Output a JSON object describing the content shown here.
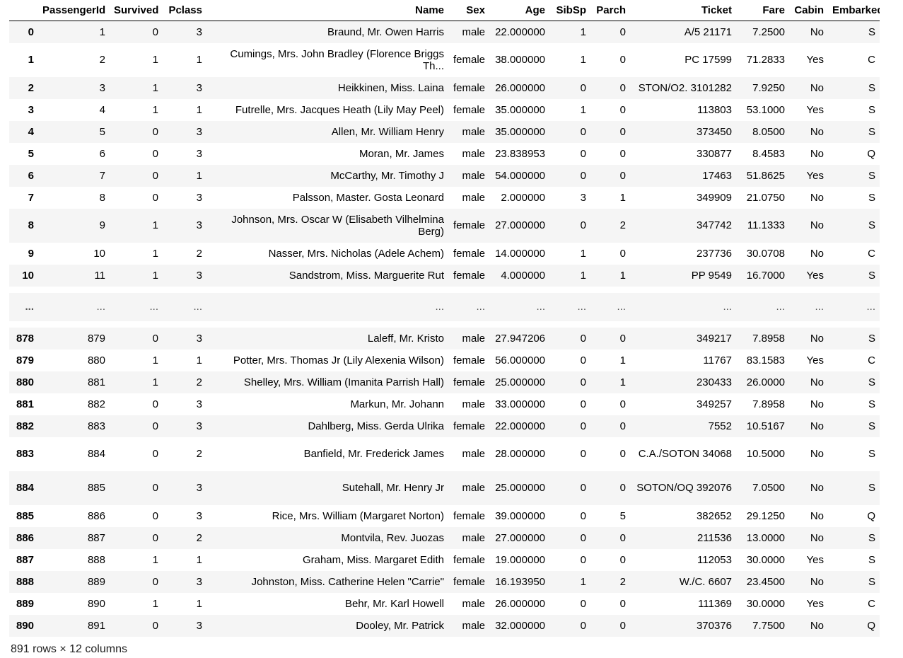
{
  "columns": [
    "",
    "PassengerId",
    "Survived",
    "Pclass",
    "Name",
    "Sex",
    "Age",
    "SibSp",
    "Parch",
    "Ticket",
    "Fare",
    "Cabin",
    "Embarked"
  ],
  "top_rows": [
    {
      "idx": "0",
      "cells": [
        "1",
        "0",
        "3",
        "Braund, Mr. Owen Harris",
        "male",
        "22.000000",
        "1",
        "0",
        "A/5 21171",
        "7.2500",
        "No",
        "S"
      ],
      "h": 31
    },
    {
      "idx": "1",
      "cells": [
        "2",
        "1",
        "1",
        "Cumings, Mrs. John Bradley (Florence Briggs Th...",
        "female",
        "38.000000",
        "1",
        "0",
        "PC 17599",
        "71.2833",
        "Yes",
        "C"
      ],
      "h": 48
    },
    {
      "idx": "2",
      "cells": [
        "3",
        "1",
        "3",
        "Heikkinen, Miss. Laina",
        "female",
        "26.000000",
        "0",
        "0",
        "STON/O2. 3101282",
        "7.9250",
        "No",
        "S"
      ],
      "h": 31
    },
    {
      "idx": "3",
      "cells": [
        "4",
        "1",
        "1",
        "Futrelle, Mrs. Jacques Heath (Lily May Peel)",
        "female",
        "35.000000",
        "1",
        "0",
        "113803",
        "53.1000",
        "Yes",
        "S"
      ],
      "h": 31
    },
    {
      "idx": "4",
      "cells": [
        "5",
        "0",
        "3",
        "Allen, Mr. William Henry",
        "male",
        "35.000000",
        "0",
        "0",
        "373450",
        "8.0500",
        "No",
        "S"
      ],
      "h": 31
    },
    {
      "idx": "5",
      "cells": [
        "6",
        "0",
        "3",
        "Moran, Mr. James",
        "male",
        "23.838953",
        "0",
        "0",
        "330877",
        "8.4583",
        "No",
        "Q"
      ],
      "h": 31
    },
    {
      "idx": "6",
      "cells": [
        "7",
        "0",
        "1",
        "McCarthy, Mr. Timothy J",
        "male",
        "54.000000",
        "0",
        "0",
        "17463",
        "51.8625",
        "Yes",
        "S"
      ],
      "h": 31
    },
    {
      "idx": "7",
      "cells": [
        "8",
        "0",
        "3",
        "Palsson, Master. Gosta Leonard",
        "male",
        "2.000000",
        "3",
        "1",
        "349909",
        "21.0750",
        "No",
        "S"
      ],
      "h": 31
    },
    {
      "idx": "8",
      "cells": [
        "9",
        "1",
        "3",
        "Johnson, Mrs. Oscar W (Elisabeth Vilhelmina Berg)",
        "female",
        "27.000000",
        "0",
        "2",
        "347742",
        "11.1333",
        "No",
        "S"
      ],
      "h": 48
    },
    {
      "idx": "9",
      "cells": [
        "10",
        "1",
        "2",
        "Nasser, Mrs. Nicholas (Adele Achem)",
        "female",
        "14.000000",
        "1",
        "0",
        "237736",
        "30.0708",
        "No",
        "C"
      ],
      "h": 31
    },
    {
      "idx": "10",
      "cells": [
        "11",
        "1",
        "3",
        "Sandstrom, Miss. Marguerite Rut",
        "female",
        "4.000000",
        "1",
        "1",
        "PP 9549",
        "16.7000",
        "Yes",
        "S"
      ],
      "h": 31
    }
  ],
  "ellipsis_row": {
    "idx": "...",
    "cells": [
      "...",
      "...",
      "...",
      "...",
      "...",
      "...",
      "...",
      "...",
      "...",
      "...",
      "...",
      "..."
    ]
  },
  "bottom_rows": [
    {
      "idx": "878",
      "cells": [
        "879",
        "0",
        "3",
        "Laleff, Mr. Kristo",
        "male",
        "27.947206",
        "0",
        "0",
        "349217",
        "7.8958",
        "No",
        "S"
      ],
      "h": 31
    },
    {
      "idx": "879",
      "cells": [
        "880",
        "1",
        "1",
        "Potter, Mrs. Thomas Jr (Lily Alexenia Wilson)",
        "female",
        "56.000000",
        "0",
        "1",
        "11767",
        "83.1583",
        "Yes",
        "C"
      ],
      "h": 31
    },
    {
      "idx": "880",
      "cells": [
        "881",
        "1",
        "2",
        "Shelley, Mrs. William (Imanita Parrish Hall)",
        "female",
        "25.000000",
        "0",
        "1",
        "230433",
        "26.0000",
        "No",
        "S"
      ],
      "h": 31
    },
    {
      "idx": "881",
      "cells": [
        "882",
        "0",
        "3",
        "Markun, Mr. Johann",
        "male",
        "33.000000",
        "0",
        "0",
        "349257",
        "7.8958",
        "No",
        "S"
      ],
      "h": 31
    },
    {
      "idx": "882",
      "cells": [
        "883",
        "0",
        "3",
        "Dahlberg, Miss. Gerda Ulrika",
        "female",
        "22.000000",
        "0",
        "0",
        "7552",
        "10.5167",
        "No",
        "S"
      ],
      "h": 31
    },
    {
      "idx": "883",
      "cells": [
        "884",
        "0",
        "2",
        "Banfield, Mr. Frederick James",
        "male",
        "28.000000",
        "0",
        "0",
        "C.A./SOTON 34068",
        "10.5000",
        "No",
        "S"
      ],
      "h": 48
    },
    {
      "idx": "884",
      "cells": [
        "885",
        "0",
        "3",
        "Sutehall, Mr. Henry Jr",
        "male",
        "25.000000",
        "0",
        "0",
        "SOTON/OQ 392076",
        "7.0500",
        "No",
        "S"
      ],
      "h": 48
    },
    {
      "idx": "885",
      "cells": [
        "886",
        "0",
        "3",
        "Rice, Mrs. William (Margaret Norton)",
        "female",
        "39.000000",
        "0",
        "5",
        "382652",
        "29.1250",
        "No",
        "Q"
      ],
      "h": 31
    },
    {
      "idx": "886",
      "cells": [
        "887",
        "0",
        "2",
        "Montvila, Rev. Juozas",
        "male",
        "27.000000",
        "0",
        "0",
        "211536",
        "13.0000",
        "No",
        "S"
      ],
      "h": 31
    },
    {
      "idx": "887",
      "cells": [
        "888",
        "1",
        "1",
        "Graham, Miss. Margaret Edith",
        "female",
        "19.000000",
        "0",
        "0",
        "112053",
        "30.0000",
        "Yes",
        "S"
      ],
      "h": 31
    },
    {
      "idx": "888",
      "cells": [
        "889",
        "0",
        "3",
        "Johnston, Miss. Catherine Helen \"Carrie\"",
        "female",
        "16.193950",
        "1",
        "2",
        "W./C. 6607",
        "23.4500",
        "No",
        "S"
      ],
      "h": 31
    },
    {
      "idx": "889",
      "cells": [
        "890",
        "1",
        "1",
        "Behr, Mr. Karl Howell",
        "male",
        "26.000000",
        "0",
        "0",
        "111369",
        "30.0000",
        "Yes",
        "C"
      ],
      "h": 31
    },
    {
      "idx": "890",
      "cells": [
        "891",
        "0",
        "3",
        "Dooley, Mr. Patrick",
        "male",
        "32.000000",
        "0",
        "0",
        "370376",
        "7.7500",
        "No",
        "Q"
      ],
      "h": 31
    }
  ],
  "footer": "891 rows × 12 columns",
  "colors": {
    "stripe": "#f5f5f5",
    "header_rule": "#000000"
  }
}
